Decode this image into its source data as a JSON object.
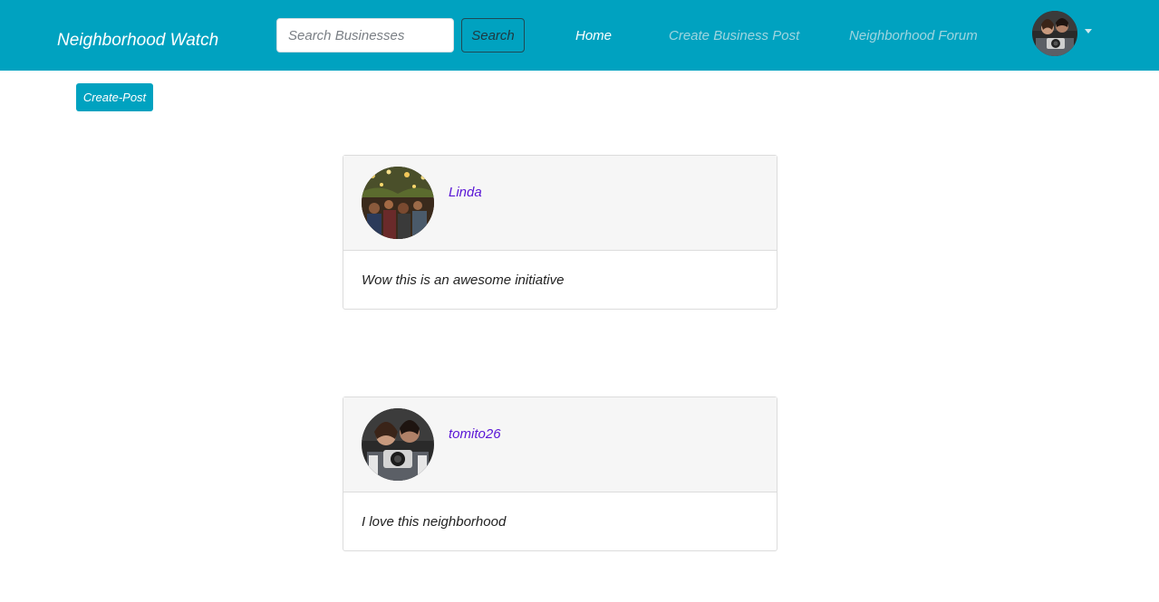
{
  "navbar": {
    "brand": "Neighborhood Watch",
    "search": {
      "placeholder": "Search Businesses",
      "value": "",
      "button_label": "Search"
    },
    "links": [
      {
        "label": "Home",
        "active": true
      },
      {
        "label": "Create Business Post",
        "active": false
      },
      {
        "label": "Neighborhood Forum",
        "active": false
      }
    ],
    "avatar_icon": "user-avatar",
    "dropdown_icon": "caret-down-icon"
  },
  "create_post_button": "Create-Post",
  "posts": [
    {
      "username": "Linda",
      "text": "Wow this is an awesome initiative"
    },
    {
      "username": "tomito26",
      "text": "I love this neighborhood"
    }
  ],
  "colors": {
    "primary": "#00a2c0",
    "username": "#5a16d6",
    "card_header": "#f6f6f6"
  }
}
